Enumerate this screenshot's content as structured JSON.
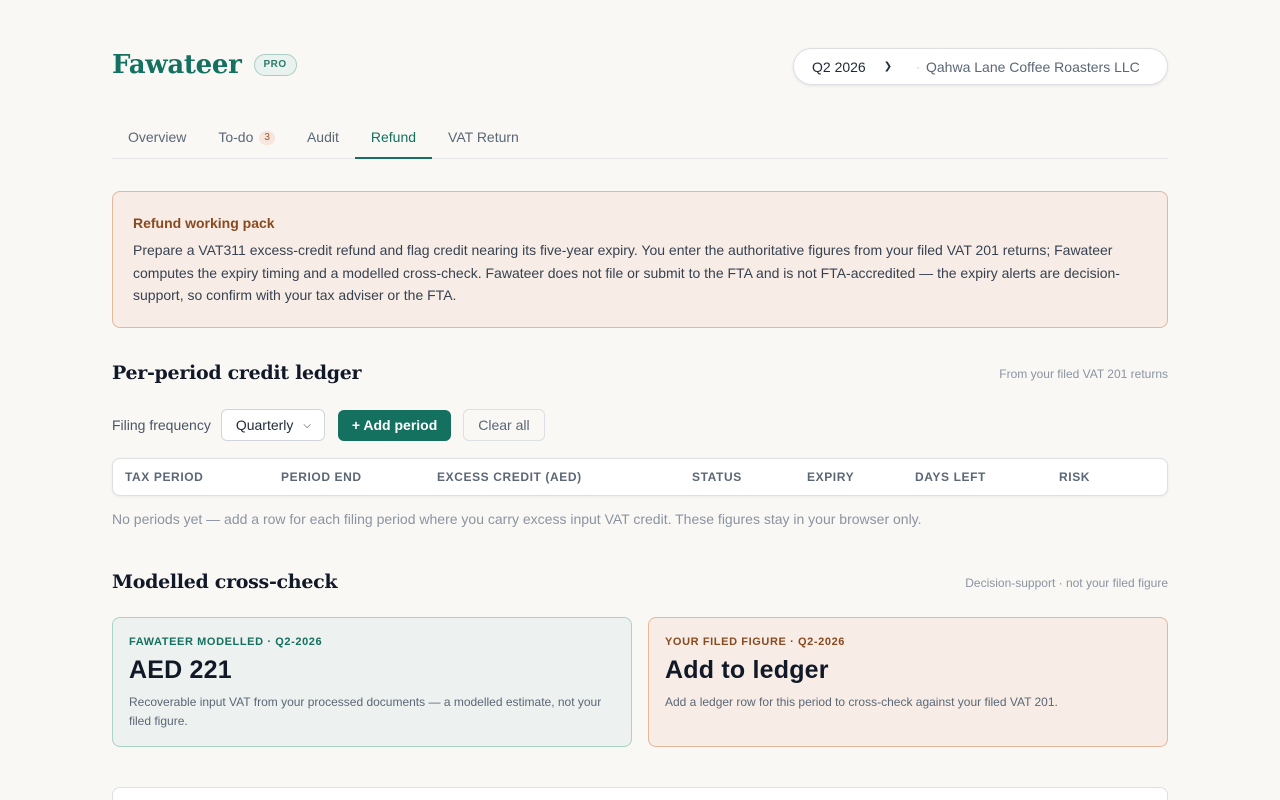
{
  "header": {
    "brand": "Fawateer",
    "badge": "PRO",
    "period": "Q2 2026",
    "company": "Qahwa Lane Coffee Roasters LLC"
  },
  "tabs": [
    {
      "label": "Overview",
      "active": false
    },
    {
      "label": "To-do",
      "count": "3",
      "active": false
    },
    {
      "label": "Audit",
      "active": false
    },
    {
      "label": "Refund",
      "active": true
    },
    {
      "label": "VAT Return",
      "active": false
    }
  ],
  "notice": {
    "title": "Refund working pack",
    "body": "Prepare a VAT311 excess-credit refund and flag credit nearing its five-year expiry. You enter the authoritative figures from your filed VAT 201 returns; Fawateer computes the expiry timing and a modelled cross-check. Fawateer does not file or submit to the FTA and is not FTA-accredited — the expiry alerts are decision-support, so confirm with your tax adviser or the FTA."
  },
  "ledger": {
    "title": "Per-period credit ledger",
    "note": "From your filed VAT 201 returns",
    "frequency_label": "Filing frequency",
    "frequency_value": "Quarterly",
    "add_button": "+ Add period",
    "clear_button": "Clear all",
    "columns": [
      "TAX PERIOD",
      "PERIOD END",
      "EXCESS CREDIT (AED)",
      "STATUS",
      "EXPIRY",
      "DAYS LEFT",
      "RISK"
    ],
    "empty_text": "No periods yet — add a row for each filing period where you carry excess input VAT credit. These figures stay in your browser only."
  },
  "crosscheck": {
    "title": "Modelled cross-check",
    "note": "Decision-support · not your filed figure",
    "modelled": {
      "label": "FAWATEER MODELLED · Q2-2026",
      "value": "AED 221",
      "desc": "Recoverable input VAT from your processed documents — a modelled estimate, not your filed figure."
    },
    "filed": {
      "label": "YOUR FILED FIGURE · Q2-2026",
      "value": "Add to ledger",
      "desc": "Add a ledger row for this period to cross-check against your filed VAT 201."
    }
  },
  "colors": {
    "accent": "#14705f",
    "warning_bg": "#f7ede6",
    "warning_border": "#e6b79a"
  }
}
